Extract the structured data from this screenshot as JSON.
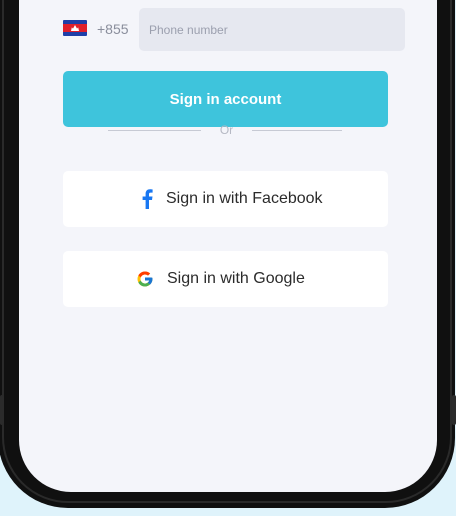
{
  "phone_login": {
    "country_code": "+855",
    "country": "Cambodia",
    "phone_placeholder": "Phone number",
    "phone_value": ""
  },
  "actions": {
    "sign_in_label": "Sign in account",
    "divider_label": "Or",
    "facebook_label": "Sign in with Facebook",
    "google_label": "Sign in with Google"
  },
  "icons": {
    "flag": "cambodia-flag-icon",
    "facebook": "facebook-icon",
    "google": "google-icon"
  },
  "colors": {
    "primary_button": "#3ec4dc",
    "screen_background": "#f4f5fa",
    "input_background": "#e6e8f0",
    "facebook_blue": "#1877f2",
    "page_background": "#dff3fb"
  }
}
